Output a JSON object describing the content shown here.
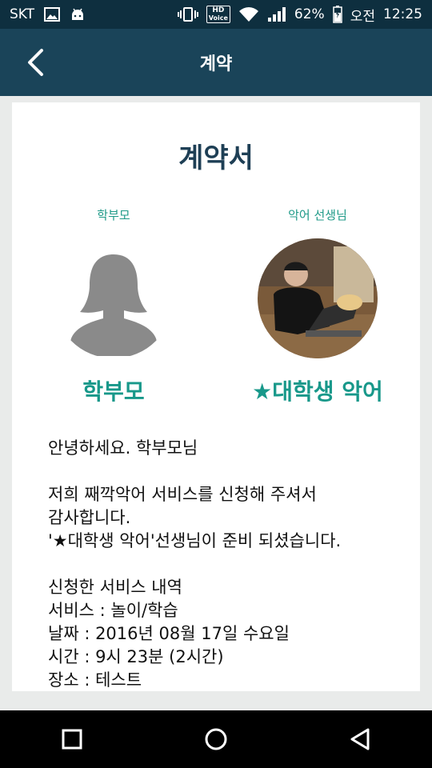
{
  "status_bar": {
    "carrier": "SKT",
    "hd_top": "HD",
    "hd_bottom": "Voice",
    "battery": "62%",
    "ampm": "오전",
    "time": "12:25",
    "icons": [
      "image-icon",
      "android-icon",
      "vibrate-icon",
      "hd-voice-icon",
      "wifi-icon",
      "signal-icon",
      "battery-icon"
    ]
  },
  "app_bar": {
    "title": "계약",
    "back_icon": "back-arrow-icon"
  },
  "contract": {
    "title": "계약서",
    "parent": {
      "role": "학부모",
      "name": "학부모",
      "avatar": "default-person-silhouette"
    },
    "teacher": {
      "role": "악어 선생님",
      "name": "★대학생 악어",
      "avatar": "teacher-photo"
    },
    "greeting": "안녕하세요. 학부모님",
    "thanks_line1": "저희 째깍악어 서비스를 신청해 주셔서",
    "thanks_line2": "감사합니다.",
    "ready_line": "'★대학생 악어'선생님이 준비 되셨습니다.",
    "details_heading": "신청한 서비스 내역",
    "service": "서비스 : 놀이/학습",
    "date": "날짜 : 2016년 08월 17일 수요일",
    "time": "시간 : 9시 23분 (2시간)",
    "place": "장소 : 테스트"
  },
  "colors": {
    "status_bar": "#0e2f3f",
    "app_bar": "#1a4459",
    "title": "#1e3f55",
    "accent": "#18988a",
    "background": "#e9ebea"
  },
  "nav_bar": {
    "icons": [
      "recent-apps-icon",
      "home-icon",
      "back-triangle-icon"
    ]
  }
}
